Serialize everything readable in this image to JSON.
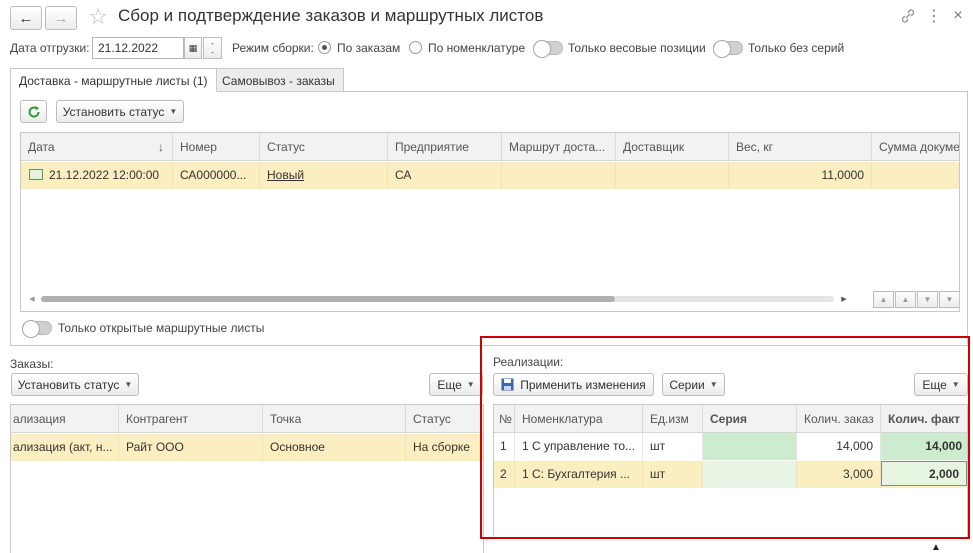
{
  "header": {
    "title": "Сбор и подтверждение заказов и маршрутных листов",
    "icons": [
      "back-arrow-icon",
      "forward-arrow-icon",
      "star-icon",
      "link-icon",
      "menu-dots-icon",
      "close-icon"
    ]
  },
  "filters": {
    "ship_date_label": "Дата отгрузки:",
    "ship_date_value": "21.12.2022",
    "mode_label": "Режим сборки:",
    "mode_options": [
      "По заказам",
      "По номенклатуре"
    ],
    "mode_selected": "По заказам",
    "toggle_weight": "Только весовые позиции",
    "toggle_no_series": "Только без серий"
  },
  "tabs": [
    {
      "label": "Доставка - маршрутные листы (1)",
      "active": true
    },
    {
      "label": "Самовывоз - заказы",
      "active": false
    }
  ],
  "top_toolbar": {
    "refresh_icon": "refresh-icon",
    "set_status_label": "Установить статус"
  },
  "routes_table": {
    "columns": [
      "Дата",
      "Номер",
      "Статус",
      "Предприятие",
      "Маршрут доста...",
      "Доставщик",
      "Вес, кг",
      "Сумма докуме"
    ],
    "rows": [
      {
        "date": "21.12.2022 12:00:00",
        "number": "СА000000...",
        "status": "Новый",
        "company": "СА",
        "route": "",
        "courier": "",
        "weight": "11,0000",
        "sum": ""
      }
    ],
    "sort_indicator": "↓"
  },
  "only_open_toggle": "Только открытые маршрутные листы",
  "orders": {
    "title": "Заказы:",
    "set_status_label": "Установить статус",
    "more_label": "Еще",
    "columns": [
      "ализация",
      "Контрагент",
      "Точка",
      "Статус"
    ],
    "rows": [
      {
        "doc": "ализация (акт, н...",
        "counterparty": "Райт ООО",
        "point": "Основное",
        "status": "На сборке"
      }
    ]
  },
  "sales": {
    "title": "Реализации:",
    "apply_label": "Применить изменения",
    "series_label": "Серии",
    "more_label": "Еще",
    "columns": [
      "№",
      "Номенклатура",
      "Ед.изм",
      "Серия",
      "Колич. заказ",
      "Колич. факт"
    ],
    "rows": [
      {
        "n": "1",
        "item": "1 С управление то...",
        "unit": "шт",
        "series": "",
        "qty_order": "14,000",
        "qty_fact": "14,000"
      },
      {
        "n": "2",
        "item": "1 С:  Бухгалтерия ...",
        "unit": "шт",
        "series": "",
        "qty_order": "3,000",
        "qty_fact": "2,000"
      }
    ]
  },
  "colors": {
    "selected_row": "#fbeec0",
    "series_cell": "#cdeccf",
    "highlight_frame": "#d00000",
    "accent_green": "#2e9b3c"
  }
}
